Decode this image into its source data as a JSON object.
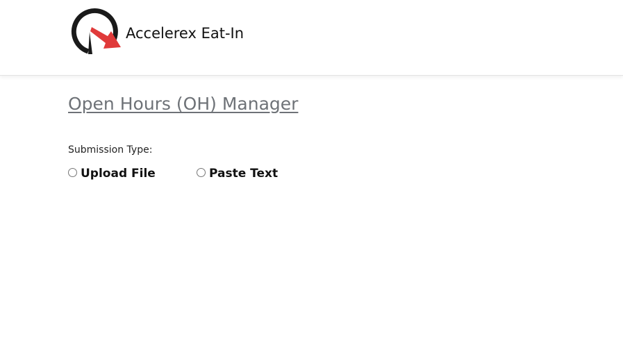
{
  "header": {
    "brand_name": "Accelerex Eat-In",
    "logo_icon": "speedometer-arrow-logo",
    "colors": {
      "logo_dark": "#1a1a1a",
      "logo_accent": "#e03a3a"
    }
  },
  "main": {
    "page_title": "Open Hours (OH) Manager",
    "page_title_color": "#6e7277",
    "submission_type": {
      "label": "Submission Type:",
      "options": [
        {
          "label": "Upload File",
          "selected": false
        },
        {
          "label": "Paste Text",
          "selected": false
        }
      ]
    }
  }
}
